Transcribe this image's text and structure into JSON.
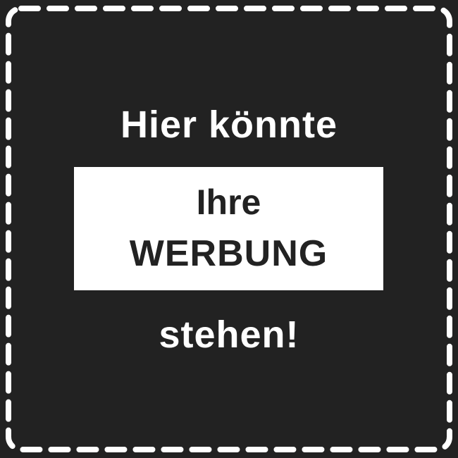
{
  "ad": {
    "line1": "Hier könnte",
    "box_line1": "Ihre",
    "box_line2": "WERBUNG",
    "line2": "stehen!"
  },
  "colors": {
    "background": "#222222",
    "foreground": "#ffffff",
    "box_text": "#222222"
  }
}
